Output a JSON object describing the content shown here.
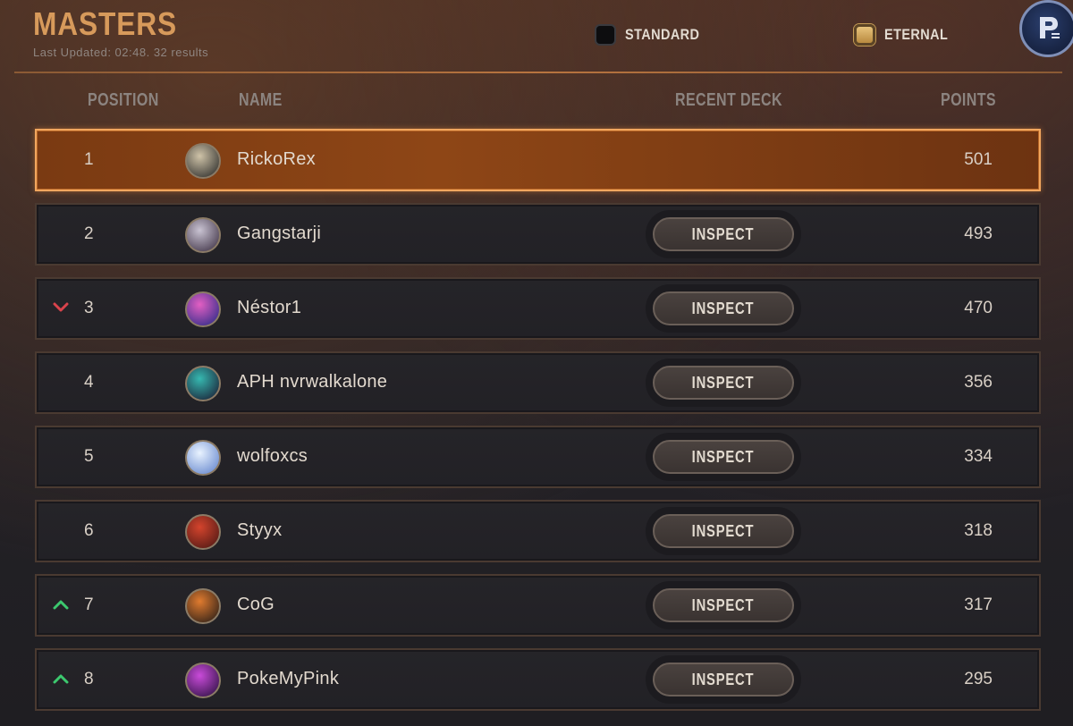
{
  "header": {
    "title": "MASTERS",
    "subtitle": "Last Updated: 02:48. 32 results",
    "modes": [
      {
        "label": "STANDARD",
        "selected": false
      },
      {
        "label": "ETERNAL",
        "selected": true
      }
    ]
  },
  "columns": {
    "position": "POSITION",
    "name": "NAME",
    "recent_deck": "RECENT DECK",
    "points": "POINTS"
  },
  "inspect_label": "INSPECT",
  "colors": {
    "accent": "#d79a5b",
    "highlight_row": "#8e4616",
    "trend_up": "#3cc86e",
    "trend_down": "#d9434b"
  },
  "rows": [
    {
      "position": "1",
      "name": "RickoRex",
      "points": "501",
      "trend": "none",
      "has_inspect": false,
      "highlight": true,
      "avatar_icon": "avatar-warrior"
    },
    {
      "position": "2",
      "name": "Gangstarji",
      "points": "493",
      "trend": "none",
      "has_inspect": true,
      "highlight": false,
      "avatar_icon": "avatar-silver-hair"
    },
    {
      "position": "3",
      "name": "Néstor1",
      "points": "470",
      "trend": "down",
      "has_inspect": true,
      "highlight": false,
      "avatar_icon": "avatar-pink-mushroom"
    },
    {
      "position": "4",
      "name": "APH nvrwalkalone",
      "points": "356",
      "trend": "none",
      "has_inspect": true,
      "highlight": false,
      "avatar_icon": "avatar-teal-mage"
    },
    {
      "position": "5",
      "name": "wolfoxcs",
      "points": "334",
      "trend": "none",
      "has_inspect": true,
      "highlight": false,
      "avatar_icon": "avatar-light-streak"
    },
    {
      "position": "6",
      "name": "Styyx",
      "points": "318",
      "trend": "none",
      "has_inspect": true,
      "highlight": false,
      "avatar_icon": "avatar-red-hair"
    },
    {
      "position": "7",
      "name": "CoG",
      "points": "317",
      "trend": "up",
      "has_inspect": true,
      "highlight": false,
      "avatar_icon": "avatar-pirate"
    },
    {
      "position": "8",
      "name": "PokeMyPink",
      "points": "295",
      "trend": "up",
      "has_inspect": true,
      "highlight": false,
      "avatar_icon": "avatar-purple-mage"
    }
  ]
}
